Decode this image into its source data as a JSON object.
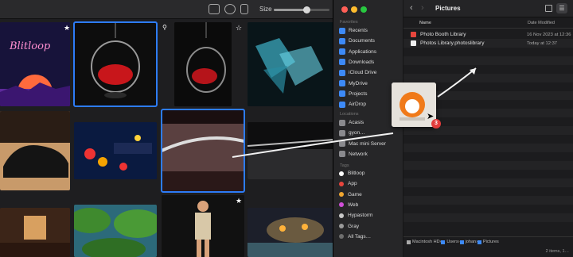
{
  "toolbar": {
    "size_label": "Size",
    "size_level": 0.58
  },
  "grid": {
    "cells": [
      {
        "name": "blitloop-poster",
        "text": "Blitloop",
        "star": true
      },
      {
        "name": "egg-chair-photo-1",
        "star": false
      },
      {
        "name": "egg-chair-photo-2",
        "star": true
      },
      {
        "name": "crystal-abstract",
        "star": false
      },
      {
        "name": "black-shoe",
        "star": false
      },
      {
        "name": "pinball-game",
        "star": false
      },
      {
        "name": "metallic-curve",
        "star": false
      },
      {
        "name": "dark-landscape-sword",
        "star": false
      },
      {
        "name": "wooden-room",
        "star": false
      },
      {
        "name": "green-islands",
        "star": false
      },
      {
        "name": "man-standing",
        "star": true
      },
      {
        "name": "orange-village",
        "star": false
      }
    ]
  },
  "finder": {
    "title": "Pictures",
    "sections": {
      "favorites": "Favorites",
      "locations": "Locations",
      "tags": "Tags"
    },
    "favorites": [
      "Recents",
      "Documents",
      "Applications",
      "Downloads",
      "iCloud Drive",
      "MyDrive",
      "Projects",
      "AirDrop"
    ],
    "locations": [
      "Acasis",
      "gyon…",
      "Mac mini Server",
      "Network"
    ],
    "tags": [
      {
        "label": "Blitloop",
        "color": "#ffffff"
      },
      {
        "label": "App",
        "color": "#e8463d"
      },
      {
        "label": "Game",
        "color": "#f0a630"
      },
      {
        "label": "Web",
        "color": "#d04fd8"
      },
      {
        "label": "Hypastorm",
        "color": "#c8c8c8"
      },
      {
        "label": "Gray",
        "color": "#9a9a9a"
      },
      {
        "label": "All Tags…",
        "color": "#6e6e6e"
      }
    ],
    "columns": {
      "name": "Name",
      "date": "Date Modified"
    },
    "files": [
      {
        "name": "Photo Booth Library",
        "date": "16 Nov 2023 at 12:36"
      },
      {
        "name": "Photos Library.photoslibrary",
        "date": "Today at 12:37"
      }
    ],
    "path": [
      "Macintosh HD",
      "Users",
      "johan",
      "Pictures"
    ],
    "status": "2 items, 1…"
  },
  "drag": {
    "count": "3"
  }
}
